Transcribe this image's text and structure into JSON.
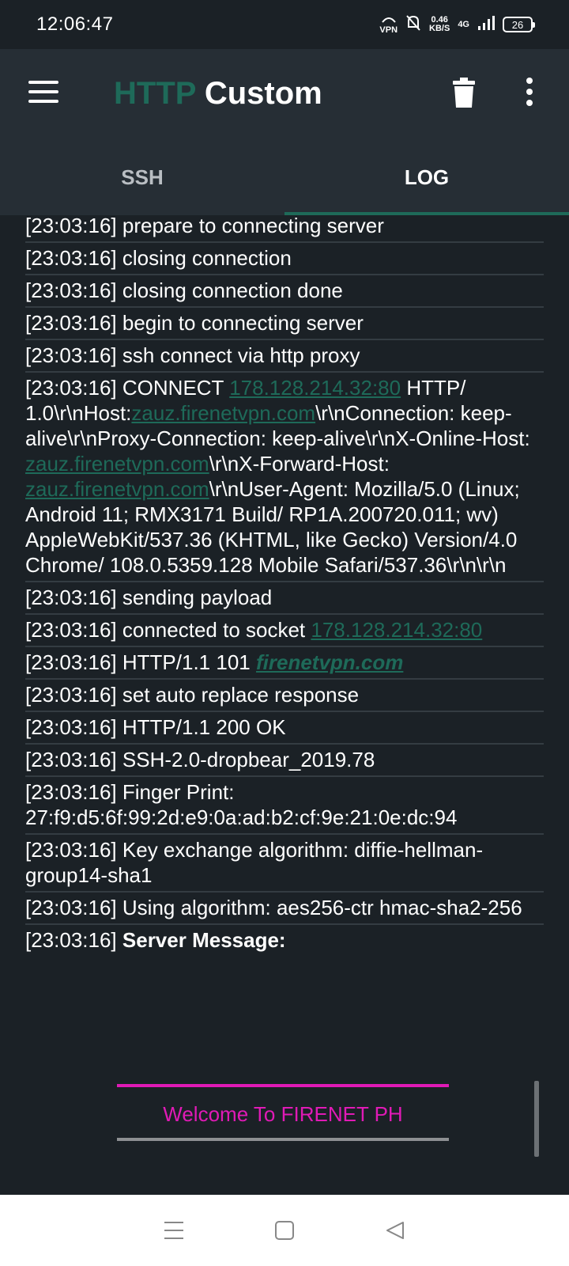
{
  "status_bar": {
    "time": "12:06:47",
    "vpn_label": "VPN",
    "speed_value": "0.46",
    "speed_unit": "KB/S",
    "network": "4G",
    "battery": "26"
  },
  "app_bar": {
    "title_accent": "HTTP",
    "title_main": "Custom"
  },
  "tabs": [
    {
      "label": "SSH",
      "active": false
    },
    {
      "label": "LOG",
      "active": true
    }
  ],
  "log": {
    "lines": [
      {
        "ts": "[23:03:16]",
        "text": "prepare to connecting server"
      },
      {
        "ts": "[23:03:16]",
        "text": "closing connection"
      },
      {
        "ts": "[23:03:16]",
        "text": "closing connection done"
      },
      {
        "ts": "[23:03:16]",
        "text": "begin to connecting server"
      },
      {
        "ts": "[23:03:16]",
        "text": "ssh connect via http proxy"
      }
    ],
    "connect_line": {
      "ts": "[23:03:16]",
      "part1": "CONNECT",
      "link1": "178.128.214.32:80",
      "part2": "HTTP/ 1.0\\r\\nHost:",
      "link2": "zauz.firenetvpn.com",
      "part3": "\\r\\nConnection: keep-alive\\r\\nProxy-Connection: keep-alive\\r\\nX-Online-Host:",
      "link3": "zauz.firenetvpn.com",
      "part4": "\\r\\nX-Forward-Host:",
      "link4": "zauz.firenetvpn.com",
      "part5": "\\r\\nUser-Agent: Mozilla/5.0 (Linux; Android 11; RMX3171 Build/ RP1A.200720.011; wv) AppleWebKit/537.36 (KHTML, like Gecko) Version/4.0 Chrome/ 108.0.5359.128 Mobile Safari/537.36\\r\\n\\r\\n"
    },
    "sending_line": {
      "ts": "[23:03:16]",
      "text": "sending payload"
    },
    "socket_line": {
      "ts": "[23:03:16]",
      "text": "connected to socket",
      "link": "178.128.214.32:80"
    },
    "http101_line": {
      "ts": "[23:03:16]",
      "text": "HTTP/1.1 101",
      "link": "firenetvpn.com"
    },
    "lines2": [
      {
        "ts": "[23:03:16]",
        "text": "set auto replace response"
      },
      {
        "ts": "[23:03:16]",
        "text": "HTTP/1.1 200 OK"
      },
      {
        "ts": "[23:03:16]",
        "text": "SSH-2.0-dropbear_2019.78"
      },
      {
        "ts": "[23:03:16]",
        "text": "Finger Print: 27:f9:d5:6f:99:2d:e9:0a:ad:b2:cf:9e:21:0e:dc:94"
      },
      {
        "ts": "[23:03:16]",
        "text": "Key exchange algorithm: diffie-hellman-group14-sha1"
      },
      {
        "ts": "[23:03:16]",
        "text": "Using algorithm: aes256-ctr hmac-sha2-256"
      }
    ],
    "server_line": {
      "ts": "[23:03:16]",
      "text": "Server Message:"
    },
    "server_message": "Welcome To FIRENET PH"
  },
  "colors": {
    "accent": "#1e6a59",
    "magenta": "#e01ab6",
    "background": "#1b2126",
    "appbar": "#262e35"
  },
  "icons": {
    "menu": "hamburger-menu-icon",
    "trash": "trash-icon",
    "more": "more-vertical-icon",
    "nav_recents": "recents-icon",
    "nav_home": "home-icon",
    "nav_back": "back-icon"
  }
}
